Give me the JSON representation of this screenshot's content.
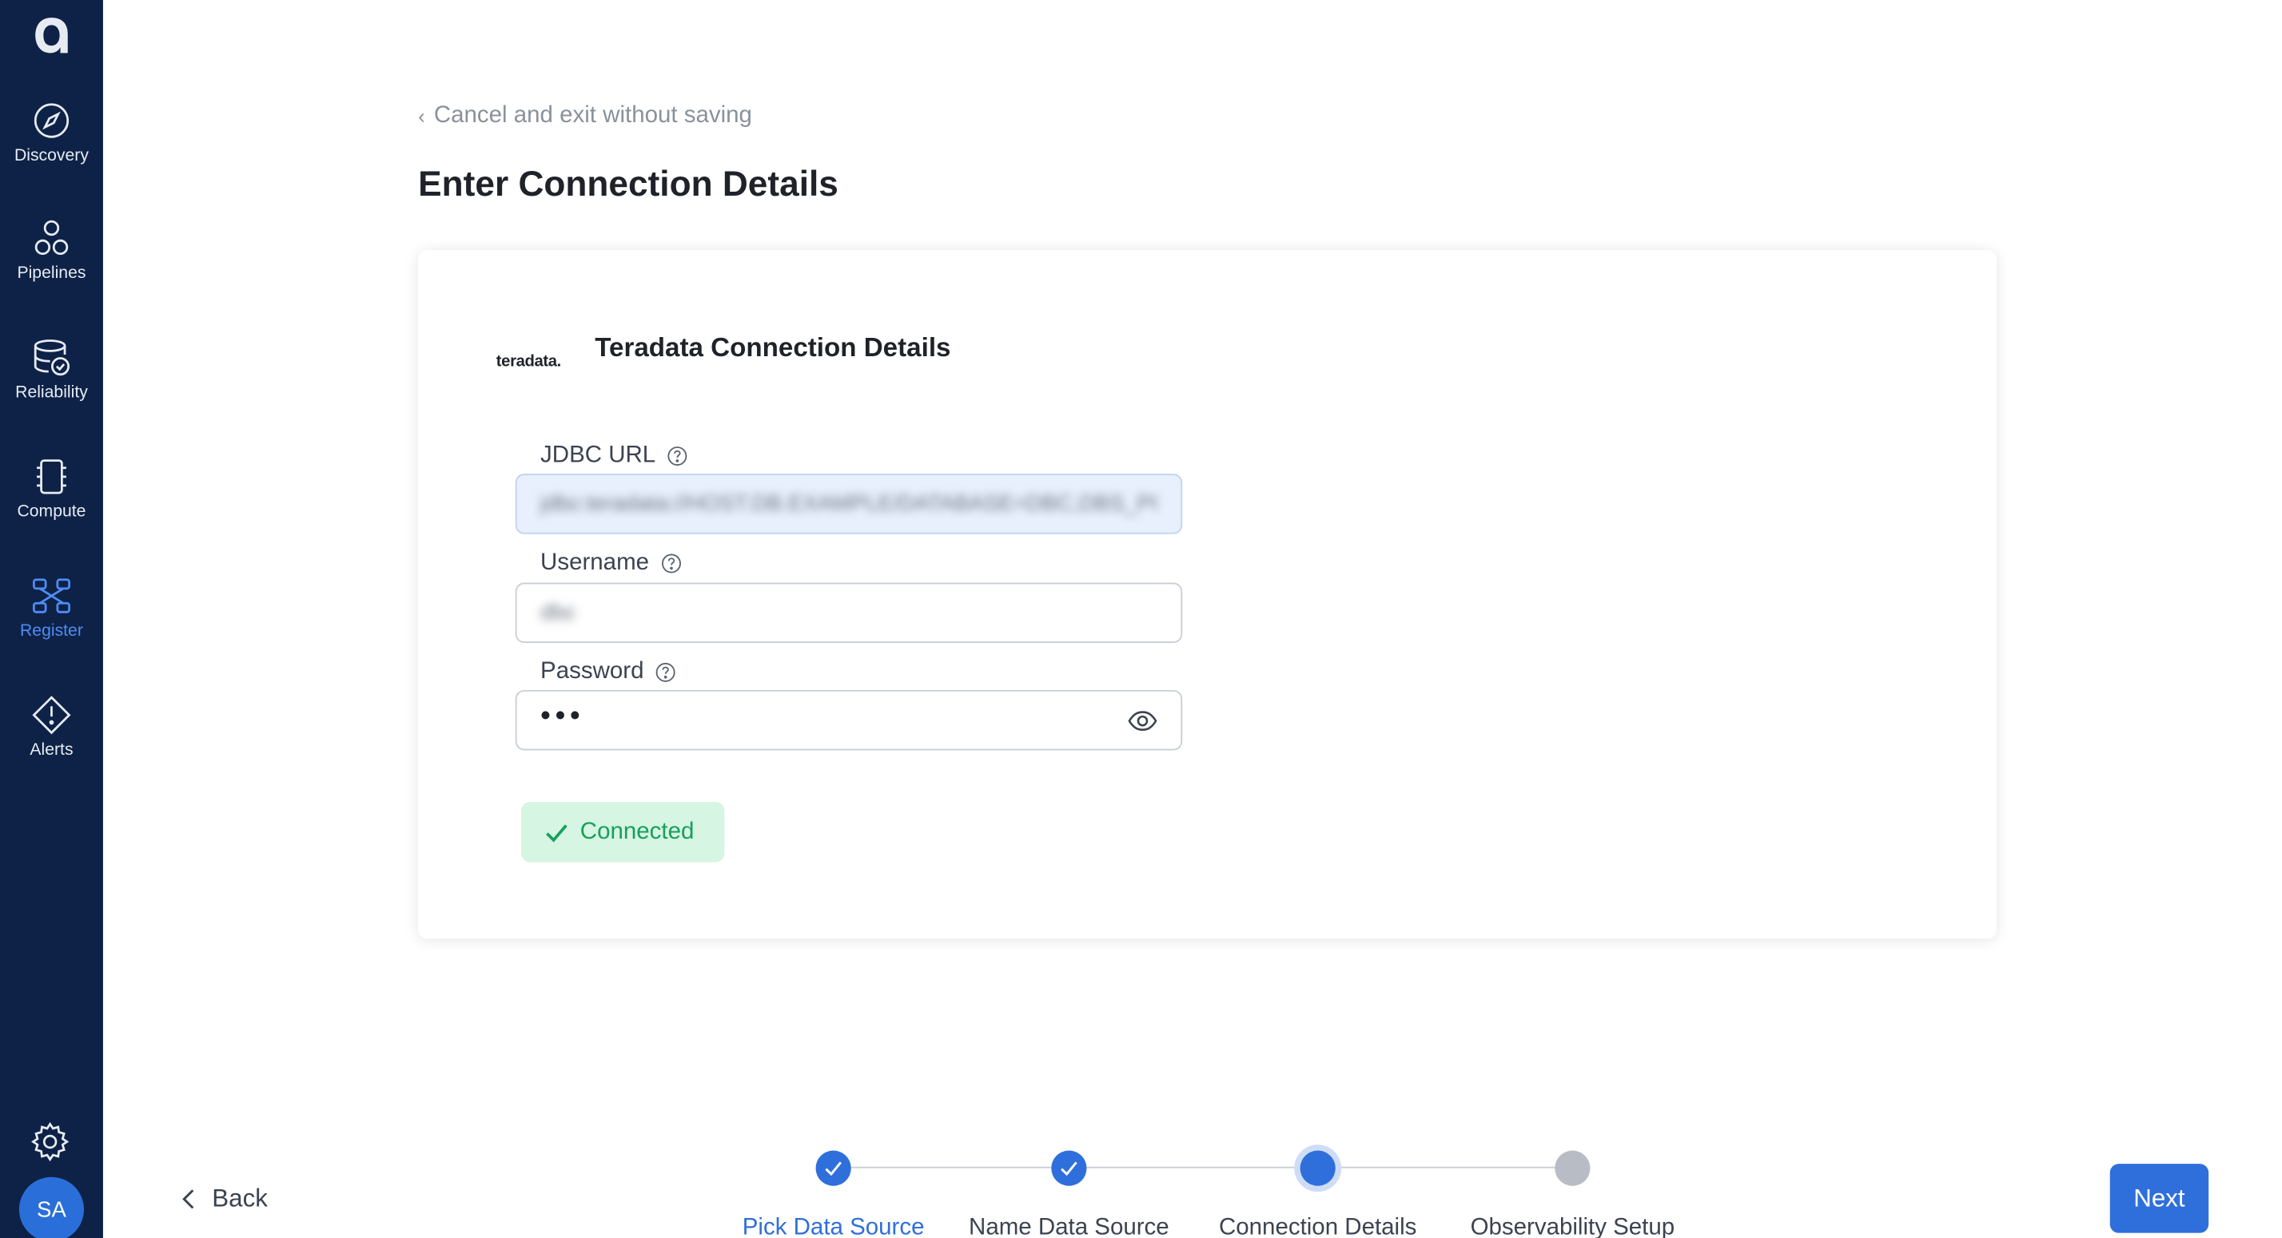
{
  "sidebar": {
    "items": [
      {
        "label": "Discovery",
        "icon": "compass-icon"
      },
      {
        "label": "Pipelines",
        "icon": "pipelines-icon"
      },
      {
        "label": "Reliability",
        "icon": "database-check-icon"
      },
      {
        "label": "Compute",
        "icon": "chip-icon"
      },
      {
        "label": "Register",
        "icon": "register-icon",
        "active": true
      },
      {
        "label": "Alerts",
        "icon": "alert-diamond-icon"
      }
    ],
    "avatar_initials": "SA"
  },
  "header": {
    "cancel_link": "Cancel and exit without saving",
    "title": "Enter Connection Details"
  },
  "card": {
    "brand_logo": "teradata.",
    "title": "Teradata Connection Details",
    "fields": {
      "jdbc": {
        "label": "JDBC URL",
        "value": "jdbc:teradata://HOST.DB.EXAMPLE/DATABASE=DBC,DBS_PORT"
      },
      "username": {
        "label": "Username",
        "value": "dbc"
      },
      "password": {
        "label": "Password",
        "value": "•••"
      }
    },
    "status": "Connected"
  },
  "footer": {
    "back": "Back",
    "next": "Next",
    "steps": [
      {
        "label": "Pick Data Source",
        "state": "done"
      },
      {
        "label": "Name Data Source",
        "state": "done"
      },
      {
        "label": "Connection Details",
        "state": "current"
      },
      {
        "label": "Observability Setup",
        "state": "pending"
      }
    ]
  },
  "colors": {
    "sidebar_bg": "#0e2247",
    "accent": "#2f6fdb",
    "success_bg": "#d6f5e3",
    "success_text": "#17a05a"
  }
}
